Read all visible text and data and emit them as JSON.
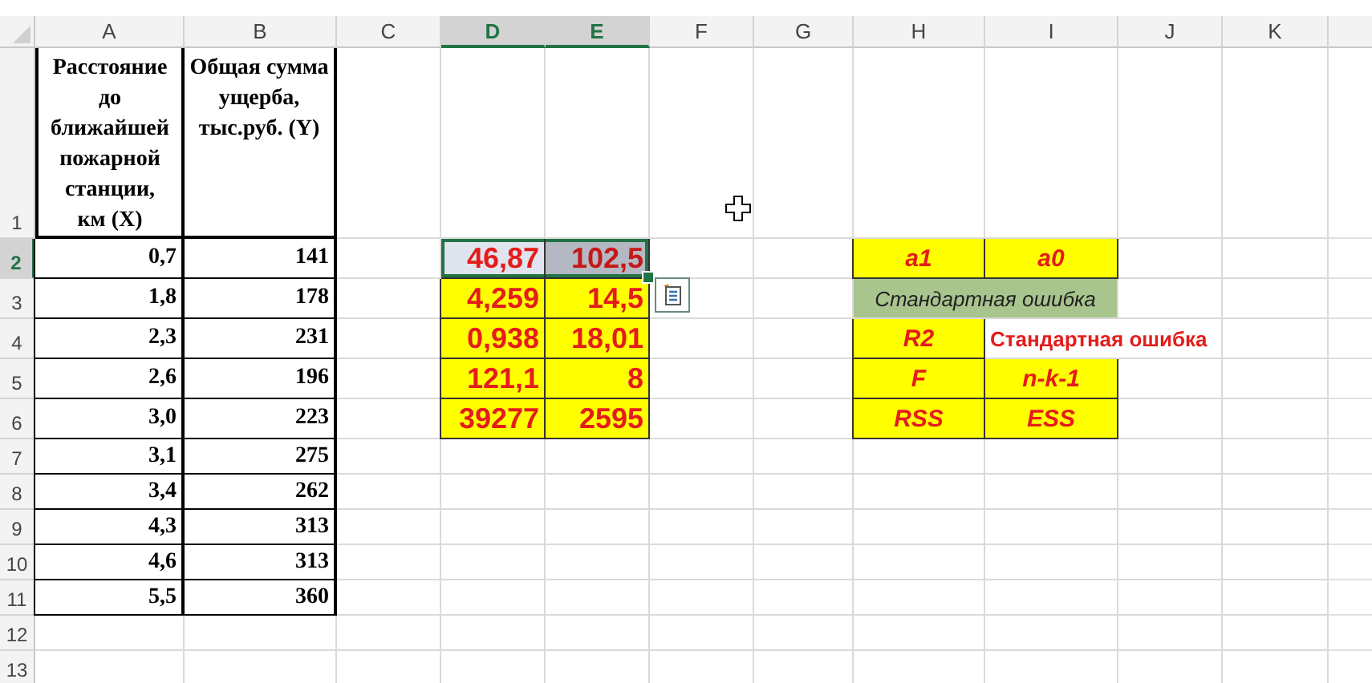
{
  "columns": [
    {
      "label": "A",
      "selected": false
    },
    {
      "label": "B",
      "selected": false
    },
    {
      "label": "C",
      "selected": false
    },
    {
      "label": "D",
      "selected": true
    },
    {
      "label": "E",
      "selected": true
    },
    {
      "label": "F",
      "selected": false
    },
    {
      "label": "G",
      "selected": false
    },
    {
      "label": "H",
      "selected": false
    },
    {
      "label": "I",
      "selected": false
    },
    {
      "label": "J",
      "selected": false
    },
    {
      "label": "K",
      "selected": false
    }
  ],
  "rows": [
    {
      "number": "1",
      "selected": false,
      "cells": [
        {
          "text": "Расстояние до ближайшей пожарной станции, км (X)",
          "kind": "header",
          "selected": false,
          "active": false
        },
        {
          "text": "Общая сумма ущерба, тыс.руб. (Y)",
          "kind": "header",
          "selected": false,
          "active": false
        },
        null,
        null,
        null,
        null,
        null,
        null,
        null,
        null,
        null
      ]
    },
    {
      "number": "2",
      "selected": true,
      "cells": [
        {
          "text": "0,7",
          "kind": "number",
          "selected": false,
          "active": false
        },
        {
          "text": "141",
          "kind": "number",
          "selected": false,
          "active": false
        },
        null,
        {
          "text": "46,87",
          "kind": "value",
          "selected": true,
          "active": true
        },
        {
          "text": "102,5",
          "kind": "value",
          "selected": true,
          "active": false
        },
        null,
        null,
        {
          "text": "a1",
          "kind": "label",
          "selected": false,
          "active": false
        },
        {
          "text": "a0",
          "kind": "label",
          "selected": false,
          "active": false
        },
        null,
        null
      ]
    },
    {
      "number": "3",
      "selected": false,
      "cells": [
        {
          "text": "1,8",
          "kind": "number",
          "selected": false,
          "active": false
        },
        {
          "text": "178",
          "kind": "number",
          "selected": false,
          "active": false
        },
        null,
        {
          "text": "4,259",
          "kind": "value",
          "selected": false,
          "active": false
        },
        {
          "text": "14,5",
          "kind": "value",
          "selected": false,
          "active": false
        },
        null,
        null,
        {
          "text": "Стандартная ошибка",
          "kind": "band",
          "merged": true,
          "selected": false,
          "active": false
        },
        null,
        null,
        null
      ]
    },
    {
      "number": "4",
      "selected": false,
      "cells": [
        {
          "text": "2,3",
          "kind": "number",
          "selected": false,
          "active": false
        },
        {
          "text": "231",
          "kind": "number",
          "selected": false,
          "active": false
        },
        null,
        {
          "text": "0,938",
          "kind": "value",
          "selected": false,
          "active": false
        },
        {
          "text": "18,01",
          "kind": "value",
          "selected": false,
          "active": false
        },
        null,
        null,
        {
          "text": "R2",
          "kind": "label",
          "selected": false,
          "active": false
        },
        {
          "text": "Стандартная ошибка",
          "kind": "note",
          "selected": false,
          "active": false
        },
        null,
        null
      ]
    },
    {
      "number": "5",
      "selected": false,
      "cells": [
        {
          "text": "2,6",
          "kind": "number",
          "selected": false,
          "active": false
        },
        {
          "text": "196",
          "kind": "number",
          "selected": false,
          "active": false
        },
        null,
        {
          "text": "121,1",
          "kind": "value",
          "selected": false,
          "active": false
        },
        {
          "text": "8",
          "kind": "value",
          "selected": false,
          "active": false
        },
        null,
        null,
        {
          "text": "F",
          "kind": "label",
          "selected": false,
          "active": false
        },
        {
          "text": "n-k-1",
          "kind": "label",
          "selected": false,
          "active": false
        },
        null,
        null
      ]
    },
    {
      "number": "6",
      "selected": false,
      "cells": [
        {
          "text": "3,0",
          "kind": "number",
          "selected": false,
          "active": false
        },
        {
          "text": "223",
          "kind": "number",
          "selected": false,
          "active": false
        },
        null,
        {
          "text": "39277",
          "kind": "value",
          "selected": false,
          "active": false
        },
        {
          "text": "2595",
          "kind": "value",
          "selected": false,
          "active": false
        },
        null,
        null,
        {
          "text": "RSS",
          "kind": "label",
          "selected": false,
          "active": false
        },
        {
          "text": "ESS",
          "kind": "label",
          "selected": false,
          "active": false
        },
        null,
        null
      ]
    },
    {
      "number": "7",
      "selected": false,
      "cells": [
        {
          "text": "3,1",
          "kind": "number",
          "selected": false,
          "active": false
        },
        {
          "text": "275",
          "kind": "number",
          "selected": false,
          "active": false
        },
        null,
        null,
        null,
        null,
        null,
        null,
        null,
        null,
        null
      ]
    },
    {
      "number": "8",
      "selected": false,
      "cells": [
        {
          "text": "3,4",
          "kind": "number",
          "selected": false,
          "active": false
        },
        {
          "text": "262",
          "kind": "number",
          "selected": false,
          "active": false
        },
        null,
        null,
        null,
        null,
        null,
        null,
        null,
        null,
        null
      ]
    },
    {
      "number": "9",
      "selected": false,
      "cells": [
        {
          "text": "4,3",
          "kind": "number",
          "selected": false,
          "active": false
        },
        {
          "text": "313",
          "kind": "number",
          "selected": false,
          "active": false
        },
        null,
        null,
        null,
        null,
        null,
        null,
        null,
        null,
        null
      ]
    },
    {
      "number": "10",
      "selected": false,
      "cells": [
        {
          "text": "4,6",
          "kind": "number",
          "selected": false,
          "active": false
        },
        {
          "text": "313",
          "kind": "number",
          "selected": false,
          "active": false
        },
        null,
        null,
        null,
        null,
        null,
        null,
        null,
        null,
        null
      ]
    },
    {
      "number": "11",
      "selected": false,
      "cells": [
        {
          "text": "5,5",
          "kind": "number",
          "selected": false,
          "active": false
        },
        {
          "text": "360",
          "kind": "number",
          "selected": false,
          "active": false
        },
        null,
        null,
        null,
        null,
        null,
        null,
        null,
        null,
        null
      ]
    },
    {
      "number": "12",
      "selected": false,
      "cells": [
        null,
        null,
        null,
        null,
        null,
        null,
        null,
        null,
        null,
        null,
        null
      ]
    },
    {
      "number": "13",
      "selected": false,
      "cells": [
        null,
        null,
        null,
        null,
        null,
        null,
        null,
        null,
        null,
        null,
        null
      ]
    }
  ]
}
